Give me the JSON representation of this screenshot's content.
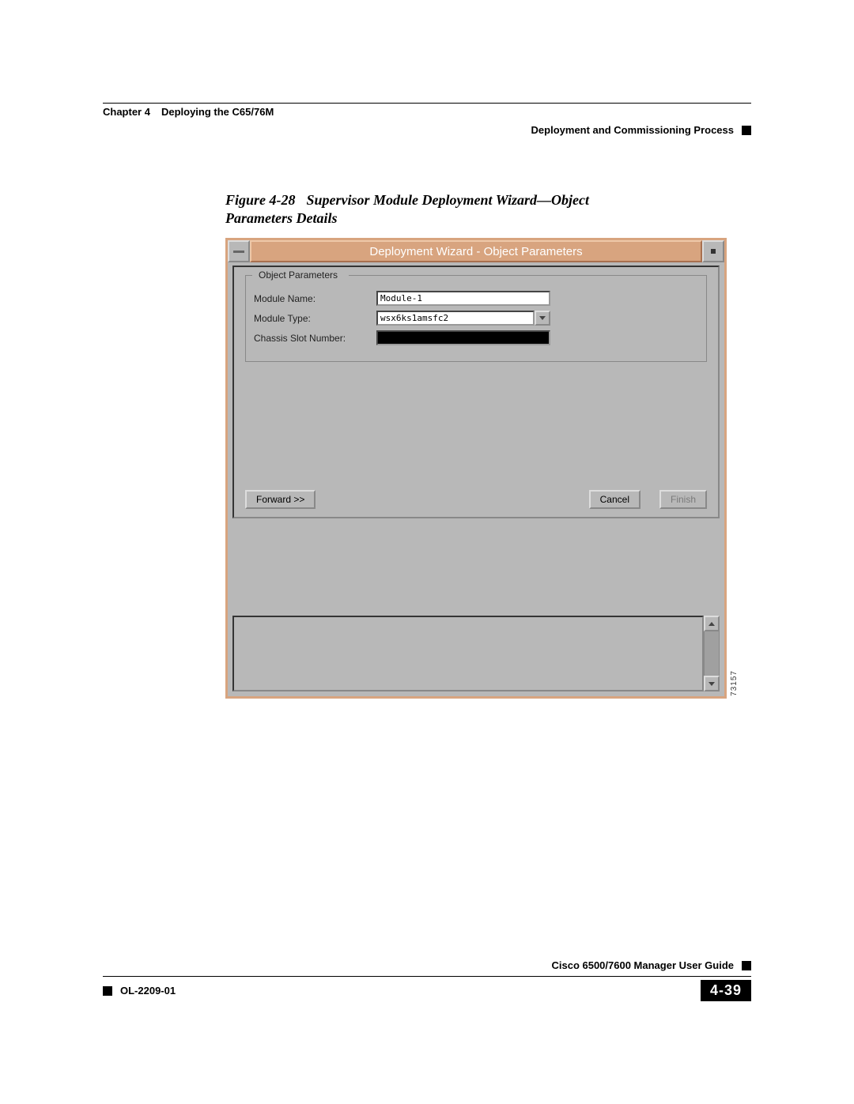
{
  "header": {
    "chapter_label": "Chapter 4",
    "chapter_title": "Deploying the C65/76M",
    "section": "Deployment and Commissioning Process"
  },
  "figure": {
    "label": "Figure 4-28",
    "title": "Supervisor Module Deployment Wizard—Object Parameters Details"
  },
  "wizard": {
    "title": "Deployment Wizard - Object Parameters",
    "fieldset_legend": "Object Parameters",
    "fields": {
      "module_name": {
        "label": "Module Name:",
        "value": "Module-1"
      },
      "module_type": {
        "label": "Module Type:",
        "value": "wsx6ks1amsfc2"
      },
      "chassis_slot": {
        "label": "Chassis Slot Number:",
        "value": ""
      }
    },
    "buttons": {
      "forward": "Forward >>",
      "cancel": "Cancel",
      "finish": "Finish"
    },
    "image_id": "73157"
  },
  "footer": {
    "guide": "Cisco 6500/7600 Manager User Guide",
    "doc_id": "OL-2209-01",
    "page": "4-39"
  }
}
